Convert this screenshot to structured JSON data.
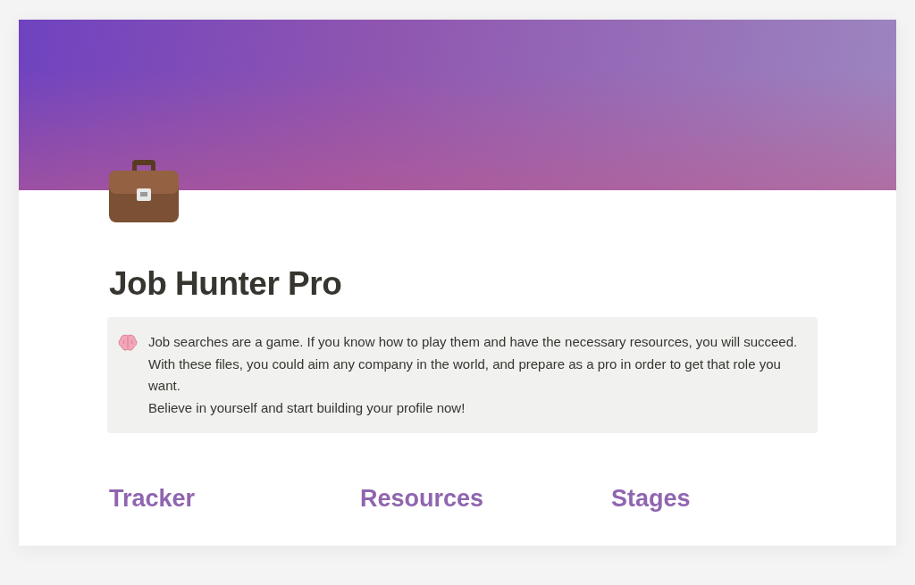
{
  "page": {
    "title": "Job Hunter Pro"
  },
  "callout": {
    "lines": [
      "Job searches are a game. If you know how to play them and have the necessary resources, you will succeed.",
      "With these files, you could aim any company in the world, and prepare as a pro in order to get that role you want.",
      "Believe in yourself and start building your profile now!"
    ]
  },
  "sections": [
    "Tracker",
    "Resources",
    "Stages"
  ]
}
